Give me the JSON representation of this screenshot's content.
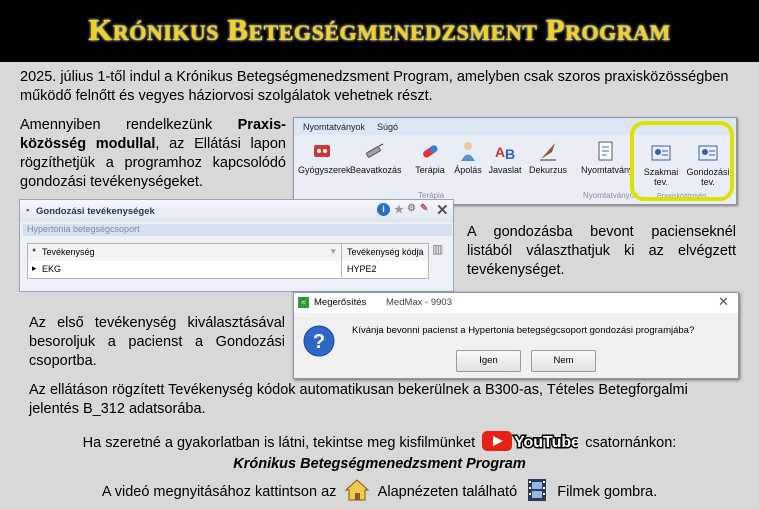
{
  "banner": {
    "title": "Krónikus Betegségmenedzsment Program"
  },
  "intro": "2025. július 1-től indul a Krónikus Betegségmenedzsment Program, amelyben csak szoros praxisközösségben működő felnőtt és vegyes háziorvosi szolgálatok vehetnek részt.",
  "module": {
    "pre": "Amennyiben rendelkezünk ",
    "bold": "Praxis-közösség modullal",
    "post": ", az Ellátási lapon rögzíthetjük a programhoz kapcsolódó gondozási tevékenységeket."
  },
  "ribbon": {
    "tabs": [
      "Nyomtatványok",
      "Súgó"
    ],
    "buttons": [
      "Gyógyszerek",
      "Beavatkozás",
      "Terápia",
      "Ápolás",
      "Javaslat",
      "Dekurzus",
      "Nyomtatvány",
      "Szakmai tev.",
      "Gondozási tev."
    ],
    "groups": [
      "Terápia",
      "Nyomtatványok",
      "Praxisközösség"
    ],
    "highlight_color": "#e0e000"
  },
  "panel": {
    "title": "Gondozási tevékenységek",
    "group": "Hypertonia betegségcsoport",
    "columns": [
      "Tevékenység",
      "Tevékenység kódja"
    ],
    "rows": [
      {
        "activity": "EKG",
        "code": "HYPE2"
      }
    ]
  },
  "select_text": "A gondozásba bevont pacienseknél listából választhatjuk ki az elvégzett tevékenységet.",
  "dialog": {
    "title": "Megerősítés",
    "app": "MedMax - 9903",
    "message": "Kívánja bevonni pacienst a Hypertonia betegségcsoport gondozási programjába?",
    "yes": "Igen",
    "no": "Nem"
  },
  "first_activity": "Az első tevékenység kiválasztásával besoroljuk a pacienst a Gondozási csoportba.",
  "codes_text": "Az ellátáson rögzített Tevékenység kódok automatikusan bekerülnek a B300-as, Tételes Betegforgalmi jelentés B_312 adatsorába.",
  "video": {
    "pre": "Ha szeretné a gyakorlatban is látni, tekintse meg kisfilmünket",
    "youtube": "YouTube",
    "post": "csatornánkon:",
    "program": "Krónikus Betegségmenedzsment Program",
    "open_pre": "A videó megnyitásához kattintson az",
    "open_mid": "Alapnézeten található",
    "open_post": "Filmek gombra."
  }
}
